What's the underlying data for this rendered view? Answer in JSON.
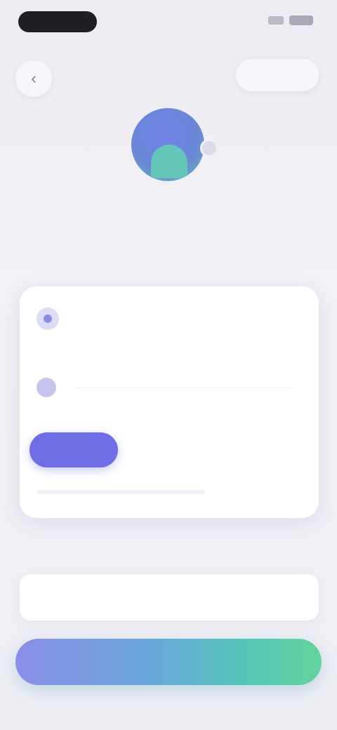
{
  "status_bar": {
    "time": "",
    "icons": [
      "signal-icon",
      "battery-icon"
    ]
  },
  "nav": {
    "back_icon": "chevron-left-icon",
    "save_label": ""
  },
  "profile": {
    "name": "",
    "subtitle": "",
    "avatar_icon": "user-avatar",
    "badge_icon": "camera-icon"
  },
  "card": {
    "title": "",
    "subtitle": "",
    "row": {
      "label": "",
      "value": ""
    },
    "tabs": [
      {
        "label": "",
        "active": true
      },
      {
        "label": "",
        "active": false
      },
      {
        "label": "",
        "active": false
      }
    ],
    "note": ""
  },
  "section": {
    "label": "",
    "input_value": "",
    "input_placeholder": ""
  },
  "primary_button": {
    "label": ""
  },
  "colors": {
    "accent": "#6f6ee6",
    "gradient_start": "#8b8ee8",
    "gradient_end": "#64d39c",
    "background": "#ececf3"
  }
}
